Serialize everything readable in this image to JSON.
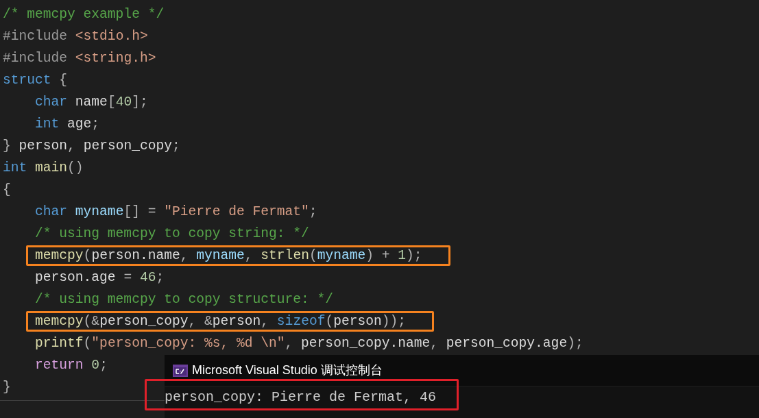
{
  "code_lines": [
    {
      "boxed": false,
      "tokens": [
        {
          "kind": "comment",
          "text": "/* memcpy example */"
        }
      ]
    },
    {
      "boxed": false,
      "tokens": [
        {
          "kind": "preproc",
          "text": "#include"
        },
        {
          "kind": "path",
          "text": " <stdio.h>"
        }
      ]
    },
    {
      "boxed": false,
      "tokens": [
        {
          "kind": "preproc",
          "text": "#include"
        },
        {
          "kind": "path",
          "text": " <string.h>"
        }
      ]
    },
    {
      "boxed": false,
      "tokens": [
        {
          "kind": "keyword",
          "text": "struct"
        },
        {
          "kind": "punct",
          "text": " {"
        }
      ]
    },
    {
      "boxed": false,
      "tokens": [
        {
          "kind": "keyword",
          "text": "    char"
        },
        {
          "kind": "plain",
          "text": " name"
        },
        {
          "kind": "punct",
          "text": "["
        },
        {
          "kind": "number",
          "text": "40"
        },
        {
          "kind": "punct",
          "text": "];"
        }
      ]
    },
    {
      "boxed": false,
      "tokens": [
        {
          "kind": "keyword",
          "text": "    int"
        },
        {
          "kind": "plain",
          "text": " age"
        },
        {
          "kind": "punct",
          "text": ";"
        }
      ]
    },
    {
      "boxed": false,
      "tokens": [
        {
          "kind": "punct",
          "text": "} "
        },
        {
          "kind": "plain",
          "text": "person"
        },
        {
          "kind": "punct",
          "text": ", "
        },
        {
          "kind": "plain",
          "text": "person_copy"
        },
        {
          "kind": "punct",
          "text": ";"
        }
      ]
    },
    {
      "boxed": false,
      "tokens": [
        {
          "kind": "keyword",
          "text": "int"
        },
        {
          "kind": "func",
          "text": " main"
        },
        {
          "kind": "punct",
          "text": "()"
        }
      ]
    },
    {
      "boxed": false,
      "tokens": [
        {
          "kind": "punct",
          "text": "{"
        }
      ]
    },
    {
      "boxed": false,
      "tokens": [
        {
          "kind": "keyword",
          "text": "    char"
        },
        {
          "kind": "local",
          "text": " myname"
        },
        {
          "kind": "punct",
          "text": "[] = "
        },
        {
          "kind": "string",
          "text": "\"Pierre de Fermat\""
        },
        {
          "kind": "punct",
          "text": ";"
        }
      ]
    },
    {
      "boxed": false,
      "tokens": [
        {
          "kind": "comment",
          "text": "    /* using memcpy to copy string: */"
        }
      ]
    },
    {
      "boxed": true,
      "tokens": [
        {
          "kind": "func",
          "text": "    memcpy"
        },
        {
          "kind": "punct",
          "text": "("
        },
        {
          "kind": "plain",
          "text": "person.name"
        },
        {
          "kind": "punct",
          "text": ", "
        },
        {
          "kind": "local",
          "text": "myname"
        },
        {
          "kind": "punct",
          "text": ", "
        },
        {
          "kind": "func",
          "text": "strlen"
        },
        {
          "kind": "punct",
          "text": "("
        },
        {
          "kind": "local",
          "text": "myname"
        },
        {
          "kind": "punct",
          "text": ") + "
        },
        {
          "kind": "number",
          "text": "1"
        },
        {
          "kind": "punct",
          "text": ");"
        }
      ]
    },
    {
      "boxed": false,
      "tokens": [
        {
          "kind": "plain",
          "text": "    person.age"
        },
        {
          "kind": "punct",
          "text": " = "
        },
        {
          "kind": "number",
          "text": "46"
        },
        {
          "kind": "punct",
          "text": ";"
        }
      ]
    },
    {
      "boxed": false,
      "tokens": [
        {
          "kind": "comment",
          "text": "    /* using memcpy to copy structure: */"
        }
      ]
    },
    {
      "boxed": true,
      "tokens": [
        {
          "kind": "func",
          "text": "    memcpy"
        },
        {
          "kind": "punct",
          "text": "(&"
        },
        {
          "kind": "plain",
          "text": "person_copy"
        },
        {
          "kind": "punct",
          "text": ", &"
        },
        {
          "kind": "plain",
          "text": "person"
        },
        {
          "kind": "punct",
          "text": ", "
        },
        {
          "kind": "keyword",
          "text": "sizeof"
        },
        {
          "kind": "punct",
          "text": "("
        },
        {
          "kind": "plain",
          "text": "person"
        },
        {
          "kind": "punct",
          "text": "));"
        }
      ]
    },
    {
      "boxed": false,
      "tokens": [
        {
          "kind": "func",
          "text": "    printf"
        },
        {
          "kind": "punct",
          "text": "("
        },
        {
          "kind": "string",
          "text": "\"person_copy: %s, %d \\n\""
        },
        {
          "kind": "punct",
          "text": ", "
        },
        {
          "kind": "plain",
          "text": "person_copy.name"
        },
        {
          "kind": "punct",
          "text": ", "
        },
        {
          "kind": "plain",
          "text": "person_copy.age"
        },
        {
          "kind": "punct",
          "text": ");"
        }
      ]
    },
    {
      "boxed": false,
      "tokens": [
        {
          "kind": "control",
          "text": "    return"
        },
        {
          "kind": "number",
          "text": " 0"
        },
        {
          "kind": "punct",
          "text": ";"
        }
      ]
    },
    {
      "boxed": false,
      "tokens": [
        {
          "kind": "punct",
          "text": "}"
        }
      ]
    }
  ],
  "console": {
    "title": "Microsoft Visual Studio 调试控制台",
    "output": "person_copy: Pierre de Fermat, 46",
    "output_boxed": true
  }
}
